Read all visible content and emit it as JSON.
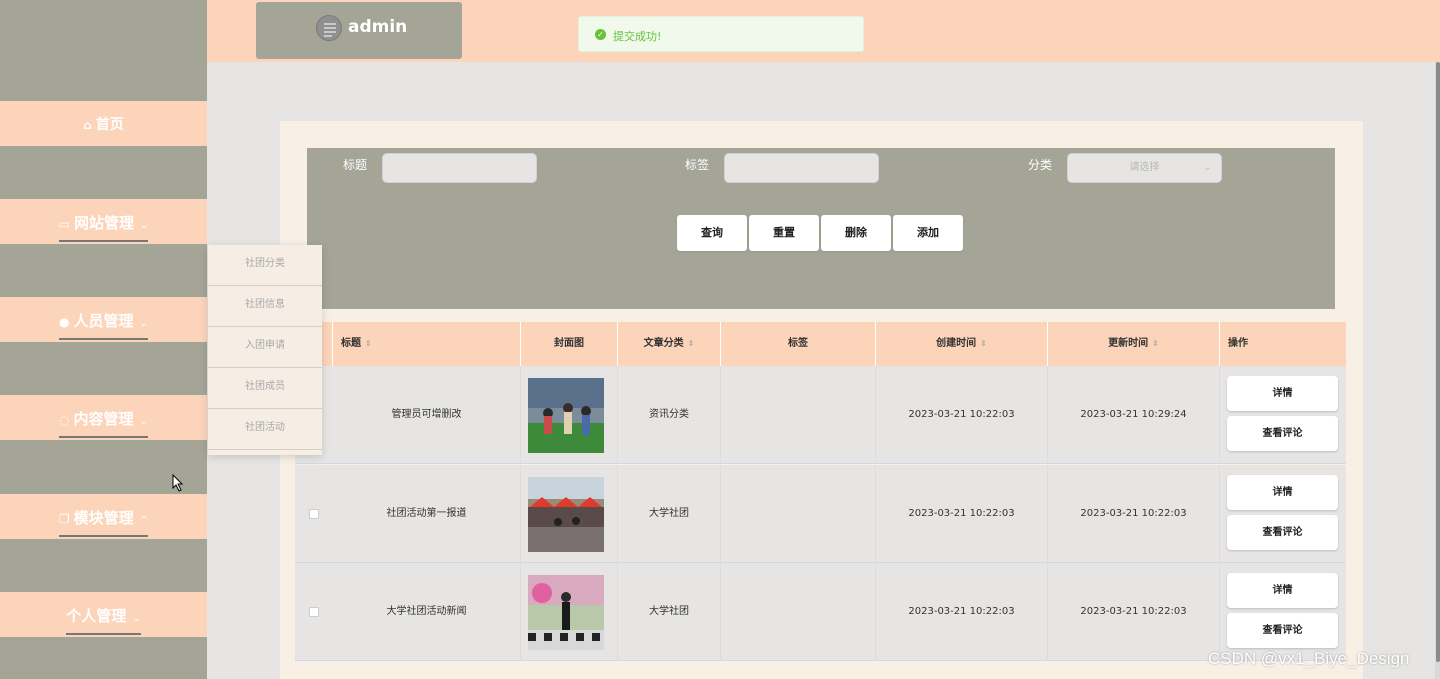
{
  "header": {
    "admin_name": "admin",
    "toast": "提交成功!"
  },
  "sidebar": {
    "items": [
      {
        "label": "首页",
        "icon": "home-icon"
      },
      {
        "label": "网站管理",
        "icon": "cart-icon"
      },
      {
        "label": "人员管理",
        "icon": "user-icon"
      },
      {
        "label": "内容管理",
        "icon": "chat-icon"
      },
      {
        "label": "模块管理",
        "icon": "copy-icon"
      },
      {
        "label": "个人管理",
        "icon": ""
      }
    ],
    "submenu": [
      "社团分类",
      "社团信息",
      "入团申请",
      "社团成员",
      "社团活动"
    ]
  },
  "search": {
    "title_label": "标题",
    "tag_label": "标签",
    "category_label": "分类",
    "category_placeholder": "请选择",
    "buttons": [
      "查询",
      "重置",
      "删除",
      "添加"
    ]
  },
  "table": {
    "headers": [
      "标题",
      "封面图",
      "文章分类",
      "标签",
      "创建时间",
      "更新时间",
      "操作"
    ],
    "rows": [
      {
        "title": "管理员可增删改",
        "category": "资讯分类",
        "tag": "",
        "created": "2023-03-21 10:22:03",
        "updated": "2023-03-21 10:29:24"
      },
      {
        "title": "社团活动第一报道",
        "category": "大学社团",
        "tag": "",
        "created": "2023-03-21 10:22:03",
        "updated": "2023-03-21 10:22:03"
      },
      {
        "title": "大学社团活动新闻",
        "category": "大学社团",
        "tag": "",
        "created": "2023-03-21 10:22:03",
        "updated": "2023-03-21 10:22:03"
      }
    ],
    "detail_label": "详情",
    "comments_label": "查看评论"
  },
  "watermark": "CSDN @vx1_Biye_Design",
  "colors": {
    "peach": "#fbd4b9",
    "olive": "#a4a597",
    "cream": "#f8efe5",
    "success": "#67c23a"
  }
}
